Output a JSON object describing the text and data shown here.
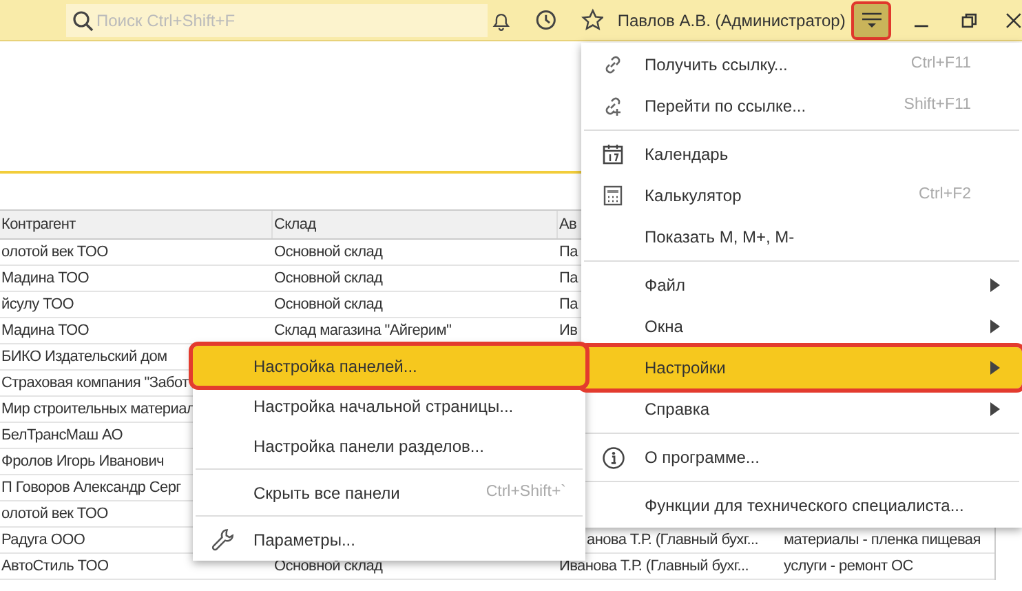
{
  "topbar": {
    "search": {
      "placeholder": "Поиск Ctrl+Shift+F"
    },
    "user": "Павлов А.В. (Администратор)",
    "menu_button": {
      "selected": true
    }
  },
  "table": {
    "columns": [
      "Контрагент",
      "Склад",
      "Ав"
    ],
    "rows": [
      [
        "олотой век ТОО",
        "Основной склад",
        "Па",
        null
      ],
      [
        "Мадина ТОО",
        "Основной склад",
        "Па",
        null
      ],
      [
        "йсулу ТОО",
        "Основной склад",
        "Па",
        null
      ],
      [
        "Мадина ТОО",
        "Склад магазина \"Айгерим\"",
        "Ив",
        null
      ],
      [
        "БИКО Издательский дом",
        null,
        null,
        null
      ],
      [
        "Страховая компания \"Забот",
        null,
        null,
        null
      ],
      [
        "Мир строительных материал",
        null,
        null,
        null
      ],
      [
        "БелТрансМаш АО",
        null,
        null,
        null
      ],
      [
        "Фролов Игорь Иванович",
        null,
        null,
        null
      ],
      [
        "П Говоров Александр Серг",
        null,
        null,
        null
      ],
      [
        "олотой век ТОО",
        null,
        null,
        null
      ],
      [
        "Радуга ООО",
        null,
        "анова Т.Р. (Главный бухг...",
        "материалы - пленка пищевая"
      ],
      [
        "АвтоСтиль ТОО",
        "Основной склад",
        "Иванова Т.Р. (Главный бухг...",
        "услуги - ремонт ОС"
      ]
    ]
  },
  "main_menu": {
    "items": [
      {
        "kind": "item",
        "label": "Получить ссылку...",
        "shortcut": "Ctrl+F11",
        "submenu": false,
        "selected": false
      },
      {
        "kind": "item",
        "label": "Перейти по ссылке...",
        "shortcut": "Shift+F11",
        "submenu": false,
        "selected": false
      },
      {
        "kind": "divider"
      },
      {
        "kind": "item",
        "label": "Календарь",
        "submenu": false,
        "selected": false
      },
      {
        "kind": "item",
        "label": "Калькулятор",
        "shortcut": "Ctrl+F2",
        "submenu": false,
        "selected": false
      },
      {
        "kind": "item",
        "label": "Показать М, М+, М-",
        "submenu": false,
        "selected": false
      },
      {
        "kind": "divider"
      },
      {
        "kind": "item",
        "label": "Файл",
        "submenu": true,
        "selected": false
      },
      {
        "kind": "item",
        "label": "Окна",
        "submenu": true,
        "selected": false
      },
      {
        "kind": "item",
        "label": "Настройки",
        "submenu": true,
        "selected": true
      },
      {
        "kind": "item",
        "label": "Справка",
        "submenu": true,
        "selected": false
      },
      {
        "kind": "divider"
      },
      {
        "kind": "item",
        "label": "О программе...",
        "submenu": false,
        "selected": false
      },
      {
        "kind": "divider"
      },
      {
        "kind": "item",
        "label": "Функции для технического специалиста...",
        "submenu": false,
        "selected": false
      }
    ]
  },
  "submenu": {
    "items": [
      {
        "kind": "item",
        "label": "Настройка панелей...",
        "selected": true
      },
      {
        "kind": "item",
        "label": "Настройка начальной страницы...",
        "selected": false
      },
      {
        "kind": "item",
        "label": "Настройка панели разделов...",
        "selected": false
      },
      {
        "kind": "divider"
      },
      {
        "kind": "item",
        "label": "Скрыть все панели",
        "shortcut": "Ctrl+Shift+`",
        "selected": false
      },
      {
        "kind": "divider"
      },
      {
        "kind": "item",
        "label": "Параметры...",
        "selected": false
      }
    ]
  }
}
